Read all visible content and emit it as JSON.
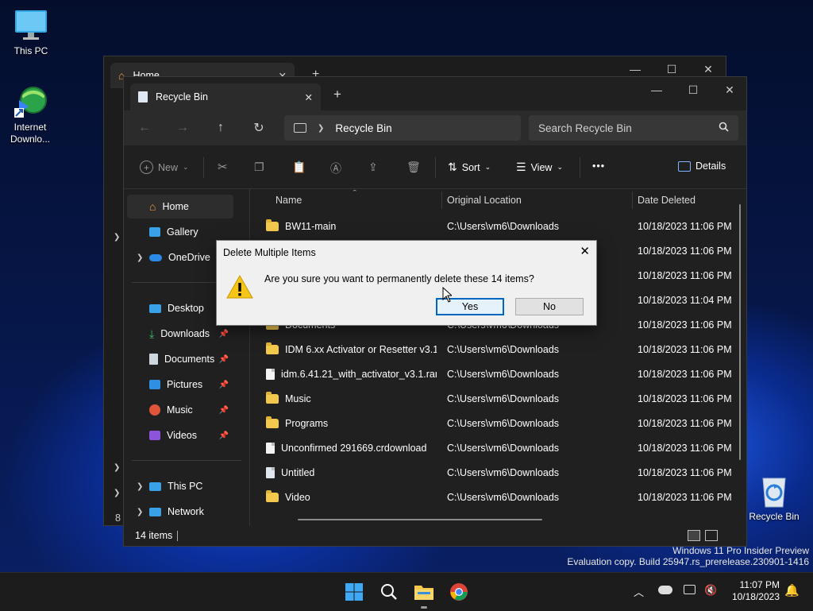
{
  "desktop": {
    "icons": [
      {
        "label": "This PC"
      },
      {
        "label": "Internet Downlo..."
      },
      {
        "label": "Recycle Bin"
      }
    ],
    "watermark": {
      "line1": "Windows 11 Pro Insider Preview",
      "line2": "Evaluation copy. Build 25947.rs_prerelease.230901-1416"
    }
  },
  "back_window": {
    "tab_title": "Home",
    "status_fragment": "8 i"
  },
  "explorer": {
    "tab_title": "Recycle Bin",
    "new_tab": "+",
    "breadcrumb": "Recycle Bin",
    "search_placeholder": "Search Recycle Bin",
    "commands": {
      "new": "New",
      "sort": "Sort",
      "view": "View",
      "more": "•••",
      "details": "Details"
    },
    "sidebar": {
      "quick": [
        {
          "label": "Home",
          "selected": true
        },
        {
          "label": "Gallery"
        },
        {
          "label": "OneDrive"
        }
      ],
      "pinned": [
        {
          "label": "Desktop"
        },
        {
          "label": "Downloads"
        },
        {
          "label": "Documents"
        },
        {
          "label": "Pictures"
        },
        {
          "label": "Music"
        },
        {
          "label": "Videos"
        }
      ],
      "drives": [
        {
          "label": "This PC"
        },
        {
          "label": "Network"
        }
      ]
    },
    "columns": {
      "name": "Name",
      "location": "Original Location",
      "date": "Date Deleted"
    },
    "rows": [
      {
        "name": "BW11-main",
        "type": "folder",
        "location": "C:\\Users\\vm6\\Downloads",
        "date": "10/18/2023 11:06 PM"
      },
      {
        "name": "",
        "type": "folder",
        "location": "",
        "date": "10/18/2023 11:06 PM"
      },
      {
        "name": "",
        "type": "folder",
        "location": "",
        "date": "10/18/2023 11:06 PM"
      },
      {
        "name": "",
        "type": "folder",
        "location": "",
        "date": "10/18/2023 11:04 PM"
      },
      {
        "name": "Documents",
        "type": "folder",
        "location": "C:\\Users\\vm6\\Downloads",
        "date": "10/18/2023 11:06 PM"
      },
      {
        "name": "IDM 6.xx Activator or Resetter v3.1",
        "type": "folder",
        "location": "C:\\Users\\vm6\\Downloads",
        "date": "10/18/2023 11:06 PM"
      },
      {
        "name": "idm.6.41.21_with_activator_v3.1.rar",
        "type": "file",
        "location": "C:\\Users\\vm6\\Downloads",
        "date": "10/18/2023 11:06 PM"
      },
      {
        "name": "Music",
        "type": "folder",
        "location": "C:\\Users\\vm6\\Downloads",
        "date": "10/18/2023 11:06 PM"
      },
      {
        "name": "Programs",
        "type": "folder",
        "location": "C:\\Users\\vm6\\Downloads",
        "date": "10/18/2023 11:06 PM"
      },
      {
        "name": "Unconfirmed 291669.crdownload",
        "type": "file",
        "location": "C:\\Users\\vm6\\Downloads",
        "date": "10/18/2023 11:06 PM"
      },
      {
        "name": "Untitled",
        "type": "doc",
        "location": "C:\\Users\\vm6\\Downloads",
        "date": "10/18/2023 11:06 PM"
      },
      {
        "name": "Video",
        "type": "folder",
        "location": "C:\\Users\\vm6\\Downloads",
        "date": "10/18/2023 11:06 PM"
      }
    ],
    "status": {
      "count": "14 items"
    }
  },
  "dialog": {
    "title": "Delete Multiple Items",
    "message": "Are you sure you want to permanently delete these 14 items?",
    "yes": "Yes",
    "no": "No"
  },
  "taskbar": {
    "time": "11:07 PM",
    "date": "10/18/2023"
  },
  "colors": {
    "accent": "#0067c0",
    "folder": "#f2c94c",
    "warning": "#f5c518"
  }
}
